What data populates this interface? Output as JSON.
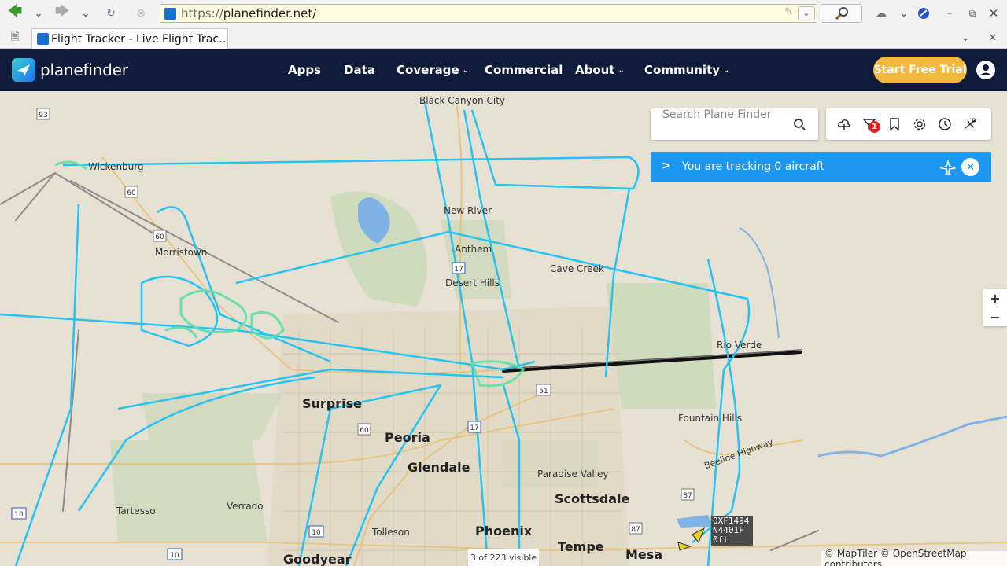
{
  "browser": {
    "url_protocol": "https://",
    "url_host": "planefinder.net/",
    "tab_title": "Flight Tracker - Live Flight Trac…"
  },
  "header": {
    "logo_text": "planefinder",
    "nav": [
      {
        "label": "Apps",
        "has_dropdown": false
      },
      {
        "label": "Data",
        "has_dropdown": false
      },
      {
        "label": "Coverage",
        "has_dropdown": true
      },
      {
        "label": "Commercial",
        "has_dropdown": false
      },
      {
        "label": "About",
        "has_dropdown": true
      },
      {
        "label": "Community",
        "has_dropdown": true
      }
    ],
    "trial_button": "Start Free Trial",
    "brand_color": "#101b3b",
    "accent_color": "#f3b93f"
  },
  "map": {
    "search_placeholder": "Search Plane Finder",
    "tools": [
      "cloud-icon",
      "filter-icon",
      "bookmark-icon",
      "settings-icon",
      "history-icon",
      "playback-icon"
    ],
    "filter_badge": "1",
    "tracking_text": "You are tracking 0 aircraft",
    "zoom_in": "+",
    "zoom_out": "−",
    "visible_count": "3 of 223 visible",
    "attribution": "© MapTiler © OpenStreetMap contributors",
    "flight_label": {
      "callsign": "OXF1494",
      "registration": "N4401F",
      "altitude": "0ft"
    },
    "places": [
      {
        "name": "Black Canyon City",
        "size": "small"
      },
      {
        "name": "Wickenburg",
        "size": "small"
      },
      {
        "name": "New River",
        "size": "small"
      },
      {
        "name": "Morristown",
        "size": "small"
      },
      {
        "name": "Anthem",
        "size": "small"
      },
      {
        "name": "Desert Hills",
        "size": "small"
      },
      {
        "name": "Cave Creek",
        "size": "small"
      },
      {
        "name": "Rio Verde",
        "size": "small"
      },
      {
        "name": "Fountain Hills",
        "size": "small"
      },
      {
        "name": "Surprise",
        "size": "big"
      },
      {
        "name": "Peoria",
        "size": "big"
      },
      {
        "name": "Glendale",
        "size": "big"
      },
      {
        "name": "Paradise Valley",
        "size": "small"
      },
      {
        "name": "Scottsdale",
        "size": "big"
      },
      {
        "name": "Phoenix",
        "size": "big"
      },
      {
        "name": "Tempe",
        "size": "big"
      },
      {
        "name": "Mesa",
        "size": "big"
      },
      {
        "name": "Goodyear",
        "size": "big"
      },
      {
        "name": "Tolleson",
        "size": "small"
      },
      {
        "name": "Tartesso",
        "size": "small"
      },
      {
        "name": "Verrado",
        "size": "small"
      },
      {
        "name": "Beeline Highway",
        "size": "small"
      }
    ],
    "route_shields": [
      "93",
      "60",
      "60",
      "17",
      "51",
      "60",
      "17",
      "87",
      "87",
      "10",
      "10",
      "10"
    ]
  }
}
